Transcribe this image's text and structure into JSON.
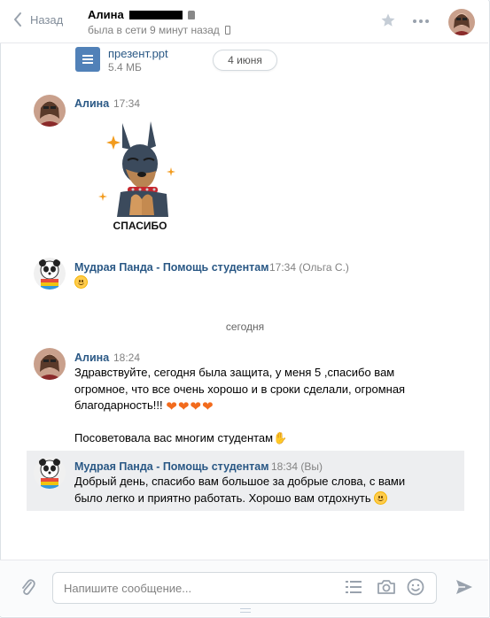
{
  "header": {
    "back_label": "Назад",
    "peer_name": "Алина",
    "peer_status": "была в сети 9 минут назад"
  },
  "attachment": {
    "file_name": "презент.ppt",
    "file_size": "5.4 МБ"
  },
  "date_pill": "4 июня",
  "messages": [
    {
      "author": "Алина",
      "time": "17:34",
      "sticker_caption": "СПАСИБО"
    },
    {
      "author": "Мудрая Панда - Помощь студентам",
      "time": "17:34 (Ольга С.)"
    },
    {
      "author": "Алина",
      "time": "18:24",
      "lines": [
        "Здравствуйте, сегодня была защита, у меня 5 ,спасибо вам",
        "огромное, что все очень хорошо и в сроки сделали, огромная",
        "благодарность!!!"
      ],
      "second_paragraph": "Посоветовала вас многим студентам"
    },
    {
      "author": "Мудрая Панда - Помощь студентам",
      "time": "18:34 (Вы)",
      "lines": [
        "Добрый день, спасибо вам большое за добрые слова, с вами",
        "было легко и приятно работать. Хорошо вам отдохнуть"
      ]
    }
  ],
  "day_separator": "сегодня",
  "composer": {
    "placeholder": "Напишите сообщение..."
  },
  "colors": {
    "link": "#2a5885",
    "muted": "#828282",
    "selected_row": "#edeef0",
    "heart": "#f26b1d"
  },
  "icons": [
    "chevron-left-icon",
    "lock-icon",
    "phone-icon",
    "star-icon",
    "more-icon",
    "document-icon",
    "smile-emoji",
    "heart-emoji",
    "ok-hand-emoji",
    "paperclip-icon",
    "list-icon",
    "camera-icon",
    "emoji-icon",
    "send-icon"
  ]
}
